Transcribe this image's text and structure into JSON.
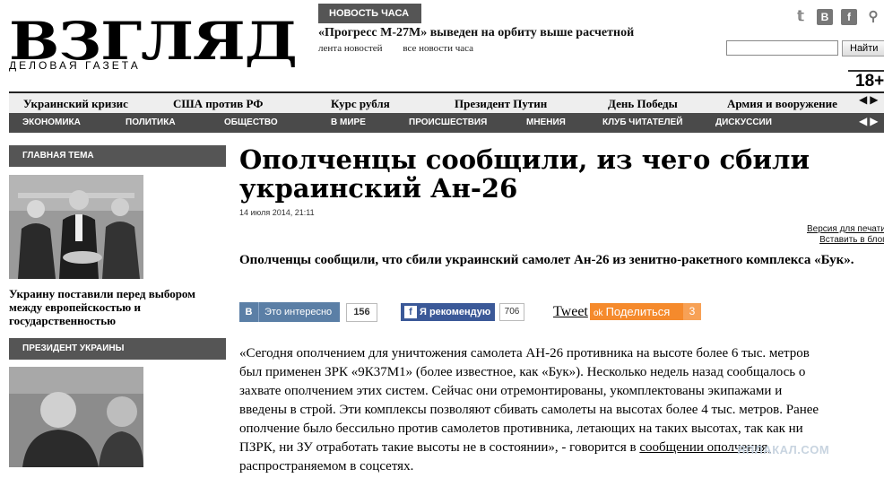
{
  "logo": {
    "main": "ВЗГЛЯД",
    "sub": "ДЕЛОВАЯ ГАЗЕТА"
  },
  "news": {
    "badge": "НОВОСТЬ ЧАСА",
    "headline": "«Прогресс М-27М» выведен на орбиту выше расчетной",
    "links": [
      "лента новостей",
      "все новости часа"
    ]
  },
  "socials": [
    {
      "name": "twitter-icon",
      "glyph": "𝕥"
    },
    {
      "name": "vk-icon",
      "glyph": "В"
    },
    {
      "name": "facebook-icon",
      "glyph": "f"
    },
    {
      "name": "share-icon",
      "glyph": "⚲"
    }
  ],
  "search": {
    "value": "",
    "button": "Найти"
  },
  "age_rating": "18+",
  "topnav": [
    "Украинский кризис",
    "США против РФ",
    "Курс рубля",
    "Президент Путин",
    "День Победы",
    "Армия и вооружение"
  ],
  "secnav": [
    "ЭКОНОМИКА",
    "ПОЛИТИКА",
    "ОБЩЕСТВО",
    "В МИРЕ",
    "ПРОИСШЕСТВИЯ",
    "МНЕНИЯ",
    "КЛУБ ЧИТАТЕЛЕЙ",
    "ДИСКУССИИ"
  ],
  "sidebar": {
    "main_topic": "ГЛАВНАЯ ТЕМА",
    "caption": "Украину поставили перед выбором между европейскостью и государственностью",
    "president": "ПРЕЗИДЕНТ УКРАИНЫ"
  },
  "article": {
    "title": "Ополченцы сообщили, из чего сбили украинский Ан-26",
    "date": "14 июля 2014, 21:11",
    "print_links": [
      "Версия для печати",
      "Вставить в блог"
    ],
    "lead": "Ополченцы сообщили, что сбили украинский самолет Ан-26 из зенитно-ракетного комплекса «Бук».",
    "body_lines": [
      "«Сегодня ополчением для уничтожения самолета АН-26 противника на высоте более 6 тыс. метров",
      "был применен ЗРК «9К37М1» (более известное, как «Бук»). Несколько недель назад сообщалось о",
      "захвате ополчением этих систем. Сейчас они отремонтированы, укомплектованы экипажами и",
      "введены в строй. Эти комплексы позволяют сбивать самолеты на высотах более 4 тыс. метров. Ранее",
      "ополчение было бессильно против самолетов противника, летающих на таких высотах, так как ни",
      "ПЗРК, ни ЗУ отработать такие высоты не в состоянии», - говорится в",
      "распространяемом в соцсетях."
    ],
    "body_link": "сообщении ополчения,"
  },
  "share": {
    "vk_label": "Это интересно",
    "vk_icon": "B",
    "vk_count": "156",
    "fb_label": "Я рекомендую",
    "fb_icon": "f",
    "fb_count": "706",
    "tweet": "Tweet",
    "ok_label": "Поделиться",
    "ok_icon": "ok",
    "ok_count": "3"
  },
  "watermark": "ЯПЛАКАЛ.COM"
}
